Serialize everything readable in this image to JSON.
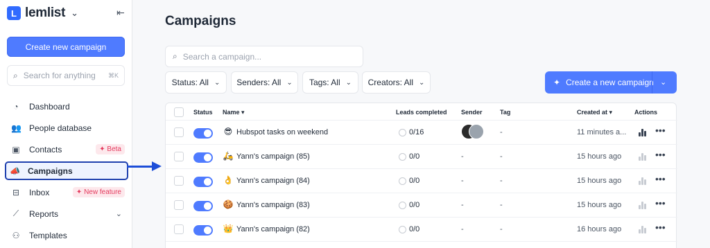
{
  "app": {
    "name": "lemlist",
    "logo_letter": "L"
  },
  "sidebar": {
    "create_label": "Create new campaign",
    "search_placeholder": "Search for anything",
    "search_shortcut": "⌘K",
    "items": [
      {
        "label": "Dashboard",
        "icon": "gauge-icon"
      },
      {
        "label": "People database",
        "icon": "people-icon"
      },
      {
        "label": "Contacts",
        "icon": "contact-card-icon",
        "badge": "Beta"
      },
      {
        "label": "Campaigns",
        "icon": "megaphone-icon",
        "active": true
      },
      {
        "label": "Inbox",
        "icon": "inbox-icon",
        "badge": "New feature"
      },
      {
        "label": "Reports",
        "icon": "chart-icon"
      },
      {
        "label": "Templates",
        "icon": "templates-icon"
      }
    ]
  },
  "main": {
    "title": "Campaigns",
    "search_placeholder": "Search a campaign...",
    "filters": [
      "Status: All",
      "Senders: All",
      "Tags: All",
      "Creators: All"
    ],
    "cta_label": "Create a new campaign",
    "columns": {
      "status": "Status",
      "name": "Name",
      "leads": "Leads completed",
      "sender": "Sender",
      "tag": "Tag",
      "created": "Created at",
      "actions": "Actions"
    },
    "rows": [
      {
        "emoji": "😎",
        "name": "Hubspot tasks on weekend",
        "leads": "0/16",
        "sender": "",
        "tag": "-",
        "created": "11 minutes a..."
      },
      {
        "emoji": "🛵",
        "name": "Yann's campaign (85)",
        "leads": "0/0",
        "sender": "-",
        "tag": "-",
        "created": "15 hours ago"
      },
      {
        "emoji": "👌",
        "name": "Yann's campaign (84)",
        "leads": "0/0",
        "sender": "-",
        "tag": "-",
        "created": "15 hours ago"
      },
      {
        "emoji": "🍪",
        "name": "Yann's campaign (83)",
        "leads": "0/0",
        "sender": "-",
        "tag": "-",
        "created": "15 hours ago"
      },
      {
        "emoji": "👑",
        "name": "Yann's campaign (82)",
        "leads": "0/0",
        "sender": "-",
        "tag": "-",
        "created": "16 hours ago"
      }
    ]
  },
  "colors": {
    "accent": "#4f7bff",
    "highlight_border": "#1e40af",
    "badge_text": "#e43a5d"
  }
}
